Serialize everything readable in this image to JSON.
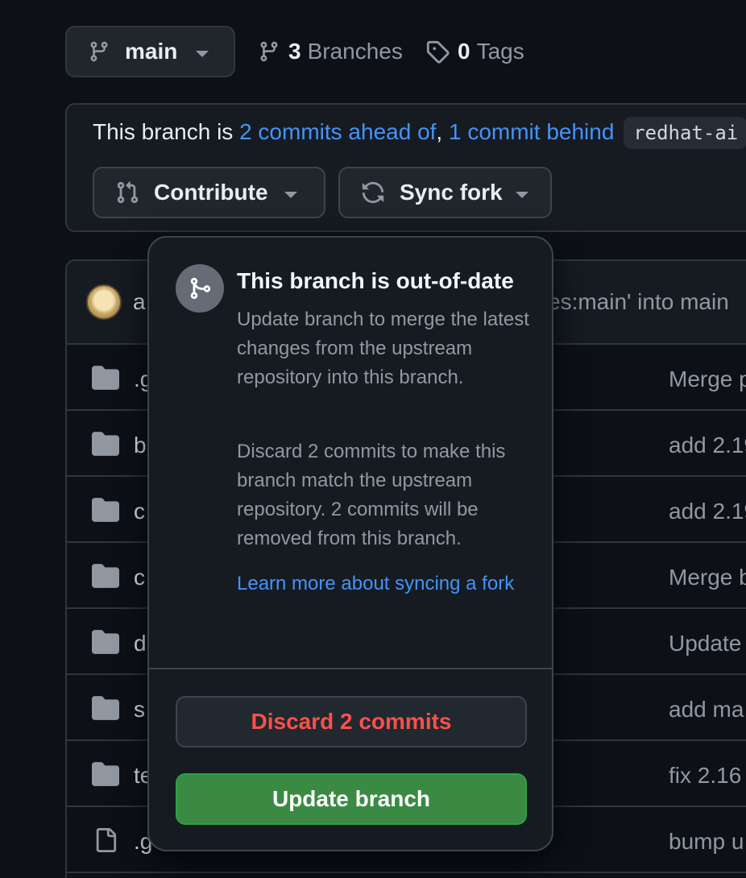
{
  "branch_selector": {
    "label": "main",
    "icon": "git-branch-icon"
  },
  "branches": {
    "count": "3",
    "label": "Branches",
    "icon": "git-branch-icon"
  },
  "tags": {
    "count": "0",
    "label": "Tags",
    "icon": "tag-icon"
  },
  "fork_status": {
    "prefix": "This branch is ",
    "ahead": "2 commits ahead of",
    "comma": ",",
    "behind": "1 commit behind",
    "upstream": "redhat-ai",
    "contribute_label": "Contribute",
    "sync_label": "Sync fork"
  },
  "commit_header": {
    "author_fragment": "a",
    "message_fragment": "es:main' into main"
  },
  "files": [
    {
      "type": "folder",
      "name": ".g",
      "message": "Merge p"
    },
    {
      "type": "folder",
      "name": "b",
      "message": "add 2.19"
    },
    {
      "type": "folder",
      "name": "c",
      "message": "add 2.19"
    },
    {
      "type": "folder",
      "name": "c",
      "message": "Merge b"
    },
    {
      "type": "folder",
      "name": "d",
      "message": "Update"
    },
    {
      "type": "folder",
      "name": "s",
      "message": "add ma"
    },
    {
      "type": "folder",
      "name": "te",
      "message": "fix 2.16"
    },
    {
      "type": "file",
      "name": ".g",
      "message": "bump u"
    }
  ],
  "popover": {
    "title": "This branch is out-of-date",
    "paragraph1": "Update branch to merge the latest changes from the upstream repository into this branch.",
    "paragraph2": "Discard 2 commits to make this branch match the upstream repository. 2 commits will be removed from this branch.",
    "learn_more": "Learn more about syncing a fork",
    "discard_label": "Discard 2 commits",
    "update_label": "Update branch"
  },
  "colors": {
    "background": "#0d1117",
    "link": "#4493f8",
    "danger": "#f85149",
    "success": "#3a8a44"
  }
}
